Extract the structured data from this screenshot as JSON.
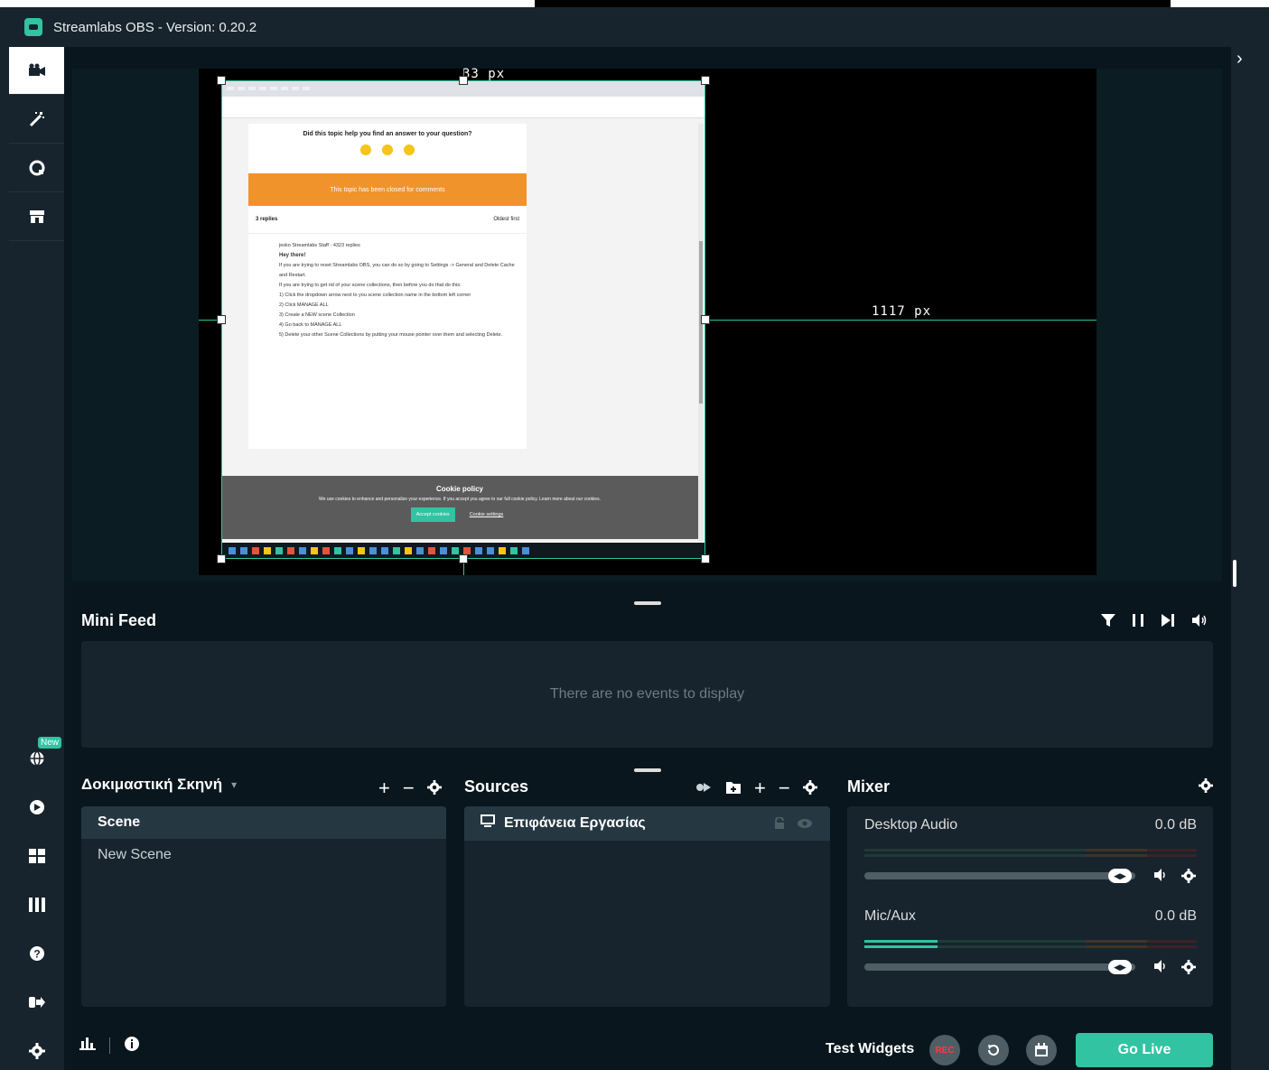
{
  "window": {
    "title": "Streamlabs OBS - Version: 0.20.2"
  },
  "sidebar": {
    "new_badge": "New"
  },
  "editor": {
    "measure_top": "33 px",
    "measure_right": "1117 px",
    "captured_page": {
      "question": "Did this topic help you find an answer to your question?",
      "closed_banner": "This topic has been closed for comments",
      "replies": "3 replies",
      "sort": "Oldest first",
      "post_author": "jesko  Streamlabs Staff · 4323 replies",
      "post_greeting": "Hey there!",
      "post_line1": "If you are trying to reset Streamlabs OBS, you can do so by going to Settings -> General and Delete Cache and Restart.",
      "post_line2": "If you are trying to get rid of your scene collections, then before you do that do this:",
      "steps": [
        "1) Click the dropdown arrow next to you scene collection name in the bottom left corner",
        "2) Click MANAGE ALL",
        "3) Create a NEW scene Collection",
        "4) Go back to MANAGE ALL",
        "5) Delete your other Scene Collections by putting your mouse pointer over them and selecting Delete."
      ],
      "cookie_title": "Cookie policy",
      "cookie_text": "We use cookies to enhance and personalize your experience. If you accept you agree to our full cookie policy. Learn more about our cookies.",
      "cookie_accept": "Accept cookies",
      "cookie_settings": "Cookie settings"
    }
  },
  "mini_feed": {
    "title": "Mini Feed",
    "empty_text": "There are no events to display"
  },
  "scenes": {
    "collection_name": "Δοκιμαστική Σκηνή",
    "items": [
      "Scene",
      "New Scene"
    ]
  },
  "sources": {
    "title": "Sources",
    "items": [
      "Επιφάνεια Εργασίας"
    ]
  },
  "mixer": {
    "title": "Mixer",
    "channels": [
      {
        "name": "Desktop Audio",
        "db": "0.0 dB",
        "volume": 1.0,
        "level": 0.0
      },
      {
        "name": "Mic/Aux",
        "db": "0.0 dB",
        "volume": 1.0,
        "level": 0.22
      }
    ]
  },
  "footer": {
    "test_widgets": "Test Widgets",
    "rec": "REC",
    "go_live": "Go Live"
  },
  "colors": {
    "accent": "#31c3a2",
    "background": "#09161d",
    "panel": "#17242d",
    "selected_row": "#253842"
  }
}
